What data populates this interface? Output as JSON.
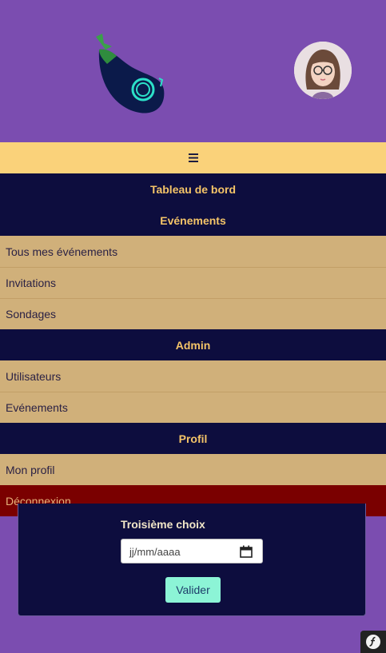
{
  "nav": {
    "toggle_icon": "hamburger-icon",
    "sections": [
      {
        "key": "dashboard",
        "label": "Tableau de bord",
        "items": []
      },
      {
        "key": "events",
        "label": "Evénements",
        "items": [
          "Tous mes événements",
          "Invitations",
          "Sondages"
        ]
      },
      {
        "key": "admin",
        "label": "Admin",
        "items": [
          "Utilisateurs",
          "Evénements"
        ]
      },
      {
        "key": "profile",
        "label": "Profil",
        "items": [
          "Mon profil"
        ]
      }
    ],
    "logout_label": "Déconnexion"
  },
  "form": {
    "third_choice_label": "Troisième choix",
    "date_placeholder": "jj/mm/aaaa",
    "submit_label": "Valider"
  },
  "colors": {
    "background": "#7b4db0",
    "menu_toggle": "#fad27a",
    "section": "#0d0d3e",
    "section_text": "#f4c468",
    "item": "#d0b07a",
    "logout": "#7a0000",
    "submit": "#8cf4d6"
  },
  "icons": {
    "logo": "eggplant-logo-icon",
    "avatar": "user-avatar",
    "calendar": "calendar-icon",
    "toolbar": "symfony-icon"
  }
}
